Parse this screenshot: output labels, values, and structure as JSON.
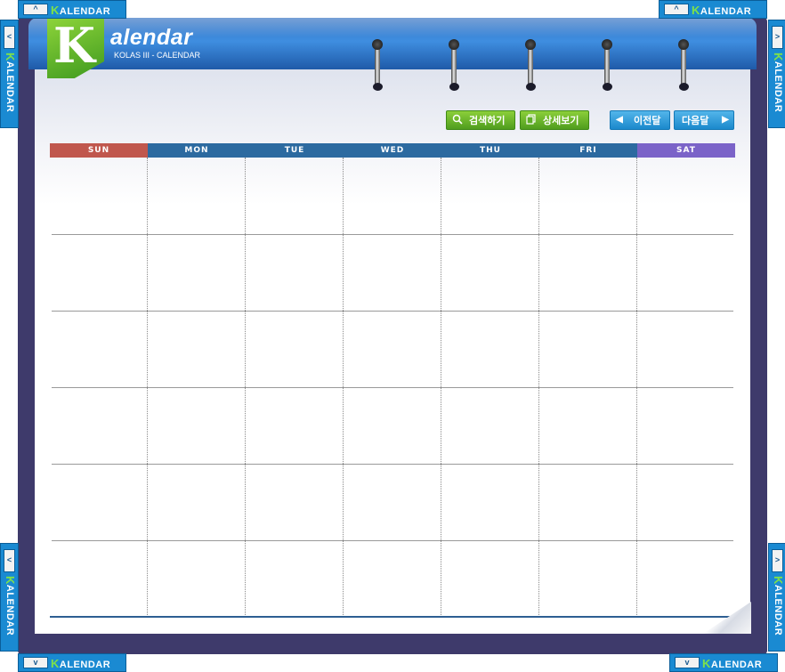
{
  "app": {
    "logo_letter": "K",
    "logo_word": "alendar",
    "logo_subtitle": "KOLAS III - CALENDAR"
  },
  "side_tabs": {
    "label_first": "K",
    "label_rest": "ALENDAR",
    "up_arrow": "^",
    "down_arrow": "v",
    "left_arrow": "<",
    "right_arrow": ">"
  },
  "toolbar": {
    "search_label": "검색하기",
    "search_icon": "magnifier-icon",
    "detail_label": "상세보기",
    "detail_icon": "pages-icon",
    "prev_label": "이전달",
    "prev_arrow": "◀",
    "next_label": "다음달",
    "next_arrow": "▶"
  },
  "calendar": {
    "days": [
      "SUN",
      "MON",
      "TUE",
      "WED",
      "THU",
      "FRI",
      "SAT"
    ],
    "weeks": 6,
    "colors": {
      "sun": "#c0574d",
      "weekday": "#2c6aa0",
      "sat": "#7b63c8",
      "frame": "#3e3a6b",
      "header": "#2f6fc0"
    }
  }
}
